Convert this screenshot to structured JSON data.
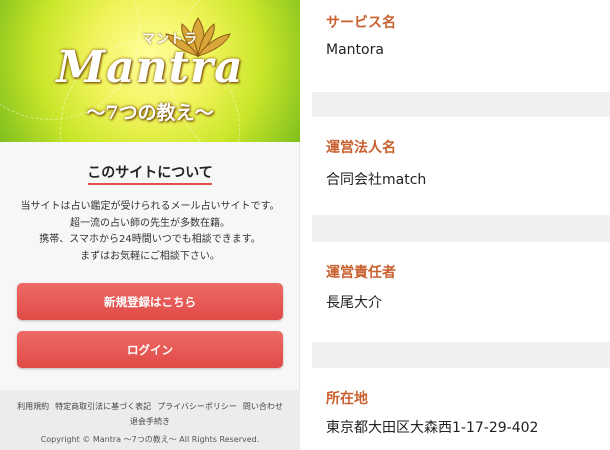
{
  "brand": {
    "name_en": "Mantra",
    "name_kana": "マントラ",
    "subtitle": "～7つの教え～"
  },
  "about": {
    "title": "このサイトについて",
    "lines": [
      "当サイトは占い鑑定が受けられるメール占いサイトです。",
      "超一流の占い師の先生が多数在籍。",
      "携帯、スマホから24時間いつでも相談できます。",
      "まずはお気軽にご相談下さい。"
    ]
  },
  "buttons": {
    "register": "新規登録はこちら",
    "login": "ログイン"
  },
  "footer": {
    "links": [
      "利用規約",
      "特定商取引法に基づく表記",
      "プライバシーポリシー",
      "問い合わせ",
      "退会手続き"
    ],
    "copyright": "Copyright © Mantra 〜7つの教え〜 All Rights Reserved."
  },
  "company_info": [
    {
      "label": "サービス名",
      "value": "Mantora"
    },
    {
      "label": "運営法人名",
      "value": "合同会社match"
    },
    {
      "label": "運営責任者",
      "value": "長尾大介"
    },
    {
      "label": "所在地",
      "value": "東京都大田区大森西1-17-29-402"
    }
  ],
  "colors": {
    "accent": "#e0514e",
    "label": "#c8612f",
    "hero_green": "#c9e62a"
  }
}
